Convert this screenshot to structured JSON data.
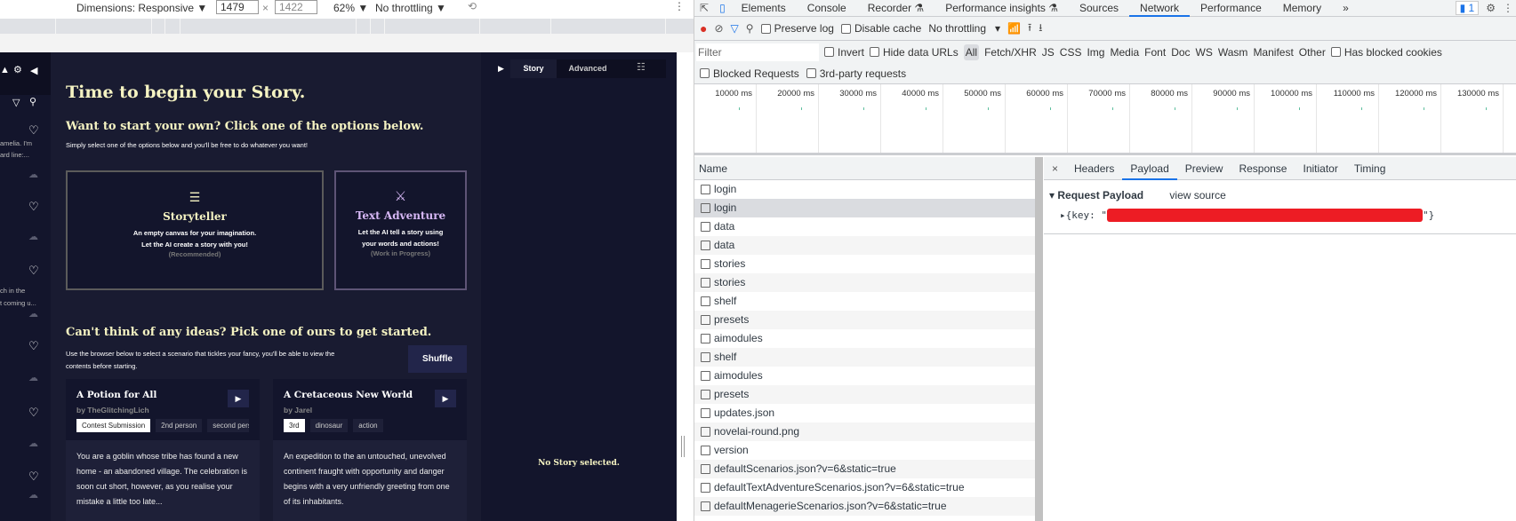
{
  "device_toolbar": {
    "dimensions": "Dimensions: Responsive ▼",
    "width": "1479",
    "x": "×",
    "height": "1422",
    "zoom": "62% ▼",
    "throttling": "No throttling ▼"
  },
  "sidebar": {
    "fragments": [
      "amelia. I'm",
      "ard line:...",
      "ch in the",
      "t coming u..."
    ]
  },
  "main": {
    "title": "Time to begin your Story.",
    "start_heading": "Want to start your own? Click one of the options below.",
    "start_sub": "Simply select one of the options below and you'll be free to do whatever you want!",
    "storyteller": {
      "title": "Storyteller",
      "line1": "An empty canvas for your imagination.",
      "line2": "Let the AI create a story with you!",
      "note": "(Recommended)"
    },
    "adventure": {
      "title": "Text Adventure",
      "line1": "Let the AI tell a story using",
      "line2": "your words and actions!",
      "note": "(Work in Progress)"
    },
    "ideas_heading": "Can't think of any ideas? Pick one of ours to get started.",
    "ideas_sub": "Use the browser below to select a scenario that tickles your fancy, you'll be able to view the contents before starting.",
    "shuffle": "Shuffle",
    "scenarios": [
      {
        "title": "A Potion for All",
        "author": "by TheGlitchingLich",
        "tags": [
          "Contest Submission",
          "2nd person",
          "second person"
        ],
        "desc": "You are a goblin whose tribe has found a new home - an abandoned village. The celebration is soon cut short, however, as you realise your mistake a little too late..."
      },
      {
        "title": "A Cretaceous New World",
        "author": "by Jarel",
        "tags": [
          "3rd",
          "dinosaur",
          "action"
        ],
        "desc": "An expedition to the an untouched, unevolved continent fraught with opportunity and danger begins with a very unfriendly greeting from one of its inhabitants."
      }
    ]
  },
  "right_panel": {
    "tabs": [
      "Story",
      "Advanced"
    ],
    "empty": "No Story selected."
  },
  "devtools": {
    "tabs": [
      "Elements",
      "Console",
      "Recorder ⚗",
      "Performance insights ⚗",
      "Sources",
      "Network",
      "Performance",
      "Memory",
      "»"
    ],
    "active_tab": "Network",
    "issues_badge": "1",
    "toolbar": {
      "preserve_log": "Preserve log",
      "disable_cache": "Disable cache",
      "throttling": "No throttling"
    },
    "filter": {
      "placeholder": "Filter",
      "invert": "Invert",
      "hide_data_urls": "Hide data URLs",
      "types": [
        "All",
        "Fetch/XHR",
        "JS",
        "CSS",
        "Img",
        "Media",
        "Font",
        "Doc",
        "WS",
        "Wasm",
        "Manifest",
        "Other"
      ],
      "has_blocked_cookies": "Has blocked cookies",
      "blocked_requests": "Blocked Requests",
      "third_party": "3rd-party requests"
    },
    "timeline": [
      "10000 ms",
      "20000 ms",
      "30000 ms",
      "40000 ms",
      "50000 ms",
      "60000 ms",
      "70000 ms",
      "80000 ms",
      "90000 ms",
      "100000 ms",
      "110000 ms",
      "120000 ms",
      "130000 ms"
    ],
    "list_header": "Name",
    "requests": [
      "login",
      "login",
      "data",
      "data",
      "stories",
      "stories",
      "shelf",
      "presets",
      "aimodules",
      "shelf",
      "aimodules",
      "presets",
      "updates.json",
      "novelai-round.png",
      "version",
      "defaultScenarios.json?v=6&static=true",
      "defaultTextAdventureScenarios.json?v=6&static=true",
      "defaultMenagerieScenarios.json?v=6&static=true"
    ],
    "detail_tabs": [
      "Headers",
      "Payload",
      "Preview",
      "Response",
      "Initiator",
      "Timing"
    ],
    "payload": {
      "title": "Request Payload",
      "view_source": "view source",
      "prefix": "{key: \"",
      "suffix": "\"}"
    }
  }
}
